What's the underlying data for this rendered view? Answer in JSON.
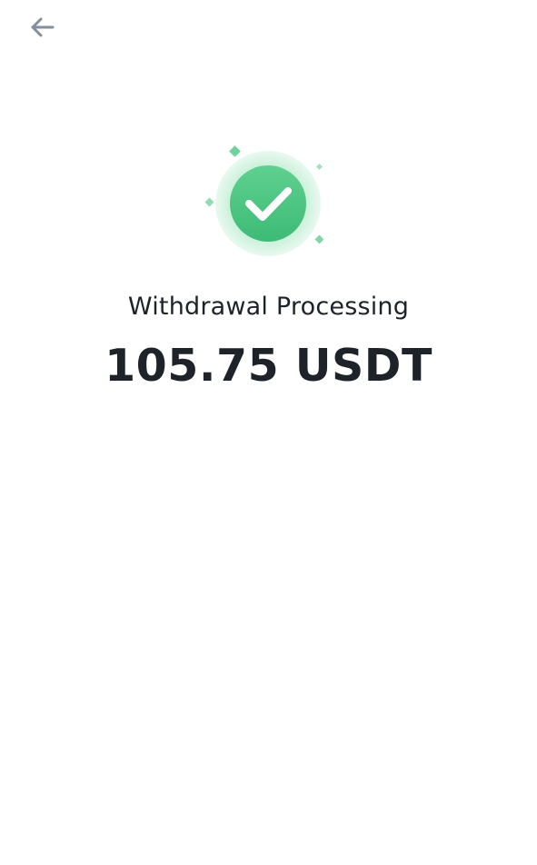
{
  "header": {
    "back_icon": "arrow-left-icon"
  },
  "status": {
    "icon": "check-circle-icon",
    "title": "Withdrawal Processing",
    "amount": "105.75 USDT"
  },
  "colors": {
    "success_green": "#3cc878",
    "success_light": "#d8f5e4",
    "text_primary": "#1e2329",
    "icon_gray": "#848e9c"
  }
}
